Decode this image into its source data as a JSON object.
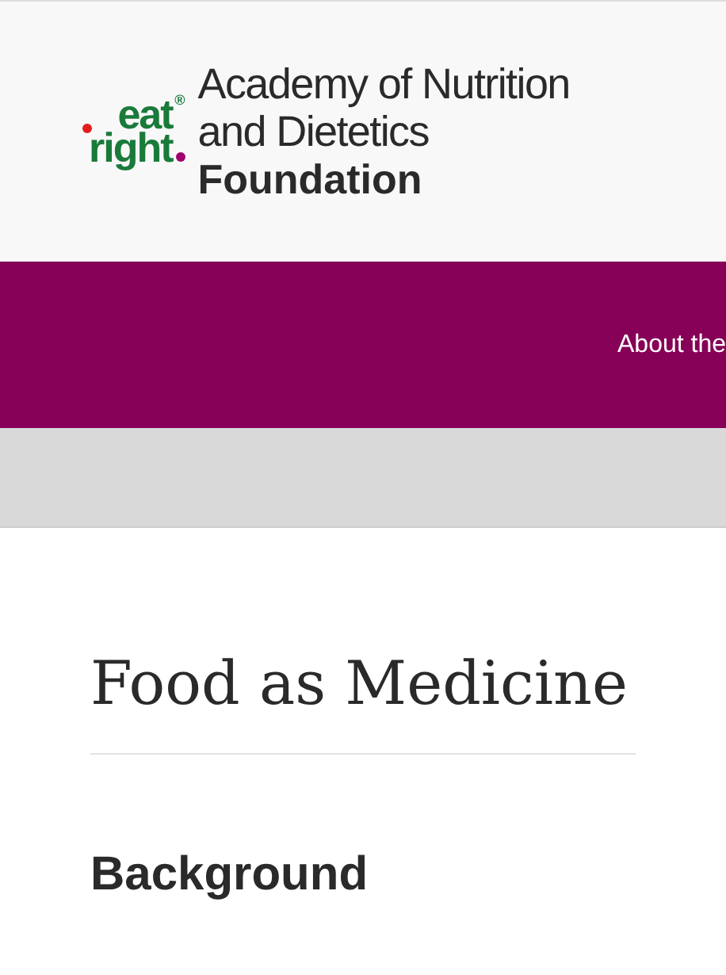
{
  "logo": {
    "mark_top": "eat",
    "mark_bottom": "right",
    "registered": "®",
    "lines": [
      "Academy of Nutrition",
      "and Dietetics"
    ],
    "bold_line": "Foundation"
  },
  "nav": {
    "items": [
      "About the"
    ]
  },
  "title": "Food as Medicine",
  "section_heading": "Background"
}
